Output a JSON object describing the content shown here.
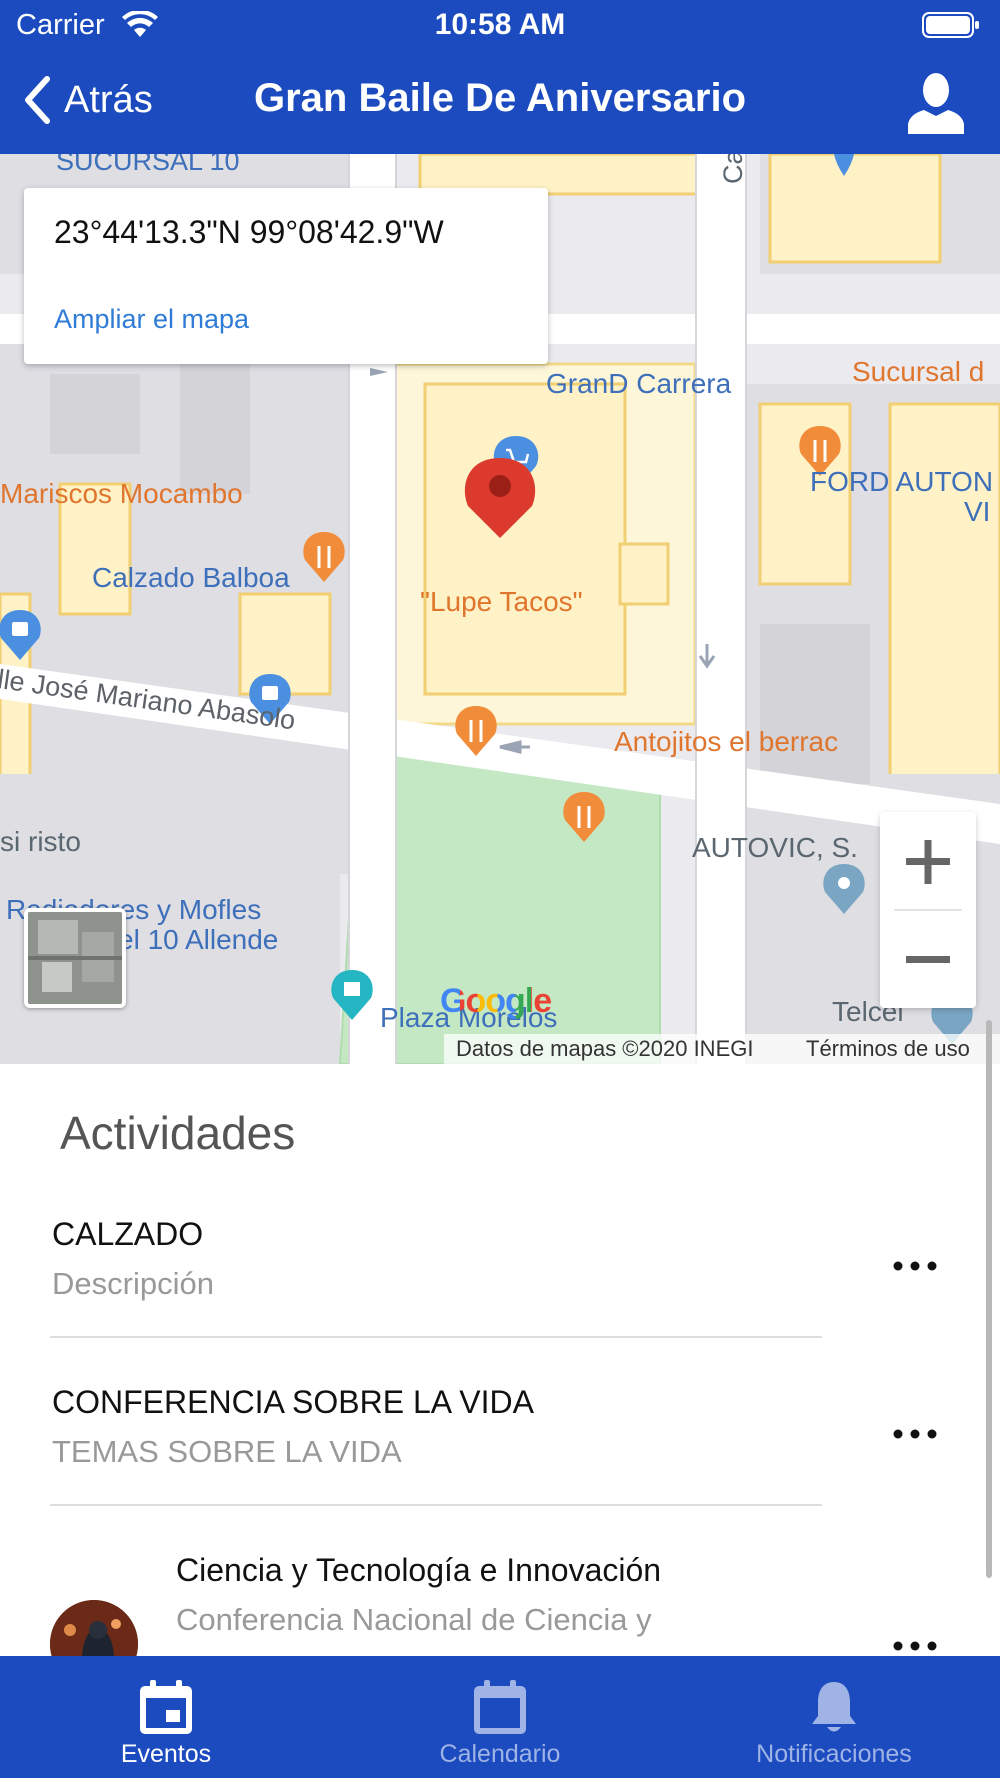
{
  "status_bar": {
    "carrier": "Carrier",
    "time": "10:58 AM"
  },
  "nav": {
    "back_label": "Atrás",
    "title": "Gran Baile De Aniversario"
  },
  "map": {
    "coordinates": "23°44'13.3\"N 99°08'42.9\"W",
    "enlarge_link": "Ampliar el mapa",
    "attribution": "Datos de mapas ©2020 INEGI",
    "terms": "Términos de uso",
    "google_logo": "Google",
    "places": {
      "sucursal_10": "SUCURSAL 10",
      "calle_top": "Calle",
      "grand_carrera": "GranD Carrera",
      "sucursal_right": "Sucursal d",
      "mariscos": "Mariscos Mocambo",
      "ford_1": "FORD AUTON",
      "ford_2": "VI",
      "calzado_balboa": "Calzado Balboa",
      "lupe_tacos": "\"Lupe Tacos\"",
      "abasolo": "lle José Mariano Abasolo",
      "antojitos": "Antojitos el berrac",
      "cristo": "si  risto",
      "autovic": "AUTOVIC, S.",
      "radiadores_1": "Radiadores y Mofles",
      "radiadores_2": "el 10 Allende",
      "plaza": "Plaza Morelos",
      "telcel": "Telcel"
    }
  },
  "activities": {
    "title": "Actividades",
    "items": [
      {
        "name": "CALZADO",
        "description": "Descripción"
      },
      {
        "name": "CONFERENCIA SOBRE LA VIDA",
        "description": "TEMAS SOBRE LA VIDA"
      },
      {
        "name": "Ciencia y Tecnología e Innovación",
        "description": "Conferencia Nacional de Ciencia y"
      }
    ]
  },
  "tabbar": {
    "tabs": [
      {
        "label": "Eventos",
        "icon": "calendar-day-icon",
        "active": true
      },
      {
        "label": "Calendario",
        "icon": "calendar-icon",
        "active": false
      },
      {
        "label": "Notificaciones",
        "icon": "bell-icon",
        "active": false
      }
    ]
  },
  "colors": {
    "primary": "#1b4bbf",
    "map_pin": "#db3a2d",
    "link": "#2f7cd6",
    "poi_orange": "#e0762e",
    "poi_blue": "#3d6fba"
  }
}
